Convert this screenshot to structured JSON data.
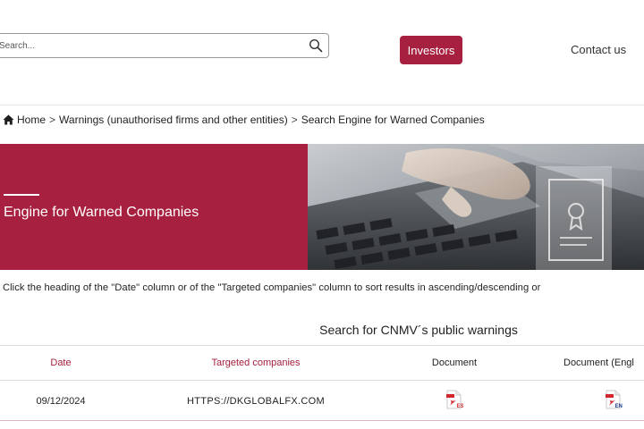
{
  "header": {
    "search_placeholder": "Search...",
    "investors_label": "Investors",
    "contact_label": "Contact us"
  },
  "breadcrumb": {
    "home": "Home",
    "separator": ">",
    "warnings": "Warnings (unauthorised firms and other entities)",
    "current": "Search Engine for Warned Companies"
  },
  "banner": {
    "title": "Engine for Warned Companies",
    "accent_color": "#a8203f"
  },
  "instructions": "Click the heading of the \"Date\" column or of the \"Targeted companies\" column to sort results in ascending/descending or",
  "table": {
    "title": "Search for CNMV´s public warnings",
    "headers": {
      "date": "Date",
      "companies": "Targeted companies",
      "document": "Document",
      "document_en": "Document (Engl"
    },
    "rows": [
      {
        "date": "09/12/2024",
        "company": "HTTPS://DKGLOBALFX.COM",
        "doc_es": "ES",
        "doc_en": "EN"
      }
    ]
  }
}
